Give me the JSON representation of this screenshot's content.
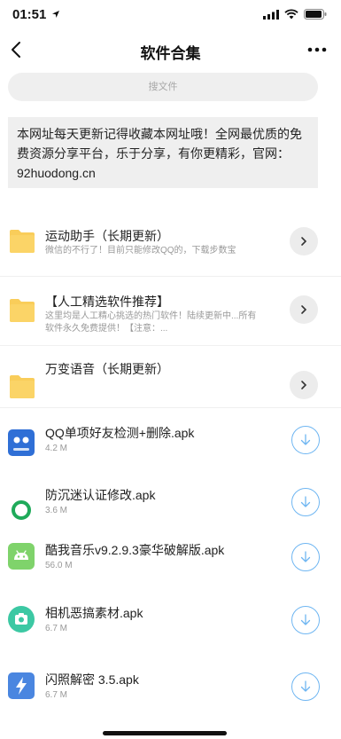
{
  "status": {
    "time": "01:51"
  },
  "nav": {
    "title": "软件合集"
  },
  "search": {
    "placeholder": "搜文件"
  },
  "notice": {
    "text": "本网址每天更新记得收藏本网址哦！全网最优质的免费资源分享平台，乐于分享，有你更精彩，官网：92huodong.cn"
  },
  "folders": [
    {
      "name": "运动助手（长期更新）",
      "desc": "微信的不行了！目前只能修改QQ的，下载步数宝"
    },
    {
      "name": "【人工精选软件推荐】",
      "desc": "这里均是人工精心挑选的热门软件！陆续更新中...所有软件永久免费提供！【注意：..."
    },
    {
      "name": "万变语音（长期更新）",
      "desc": ""
    }
  ],
  "files": [
    {
      "name": "QQ单项好友检测+删除.apk",
      "size": "4.2 M",
      "icon": "qq-friend-app-icon",
      "color": "#2f6fd6"
    },
    {
      "name": "防沉迷认证修改.apk",
      "size": "3.6 M",
      "icon": "ring-app-icon",
      "color": "#1faa5a"
    },
    {
      "name": "酷我音乐v9.2.9.3豪华破解版.apk",
      "size": "56.0 M",
      "icon": "android-icon",
      "color": "#7fd36b"
    },
    {
      "name": "相机恶搞素材.apk",
      "size": "6.7 M",
      "icon": "camera-icon",
      "color": "#3cc8a3"
    },
    {
      "name": "闪照解密 3.5.apk",
      "size": "6.7 M",
      "icon": "lightning-icon",
      "color": "#4a86e0"
    }
  ],
  "colors": {
    "accent": "#6fb6f2",
    "folder": "#f9cd5a"
  }
}
